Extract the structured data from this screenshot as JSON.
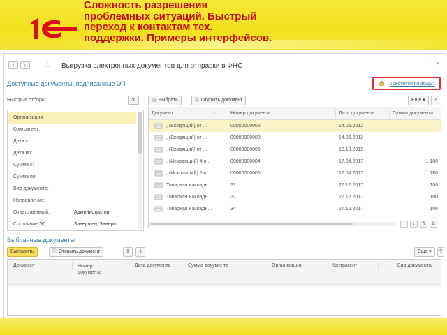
{
  "banner": {
    "title_lines": [
      "Сложность разрешения",
      "проблемных ситуаций. Быстрый",
      "переход к контактам тех.",
      "поддержки. Примеры интерфейсов."
    ],
    "logo_icon": "1c-logo-icon",
    "colors": {
      "banner": "#f3e11c",
      "title": "#c40e0e",
      "logo": "#d8101a"
    }
  },
  "window": {
    "title": "Выгрузка электронных документов для отправки в ФНС",
    "help_link": "Требуется помощь?",
    "nav": {
      "back": "‹",
      "forward": "›"
    },
    "controls": [
      "⋮",
      "×"
    ]
  },
  "top_section": {
    "title": "Доступные документы, подписанные ЭП",
    "filters_label": "Быстрые отборы:",
    "filters_clear": "×",
    "filters": [
      {
        "label": "Организация",
        "value": ""
      },
      {
        "label": "Контрагент:",
        "value": ""
      },
      {
        "label": "Дата с:",
        "value": ""
      },
      {
        "label": "Дата по:",
        "value": ""
      },
      {
        "label": "Сумма с:",
        "value": ""
      },
      {
        "label": "Сумма по:",
        "value": ""
      },
      {
        "label": "Вид документа:",
        "value": ""
      },
      {
        "label": "Направление:",
        "value": ""
      },
      {
        "label": "Ответственный:",
        "value": "Администратор"
      },
      {
        "label": "Состояние ЭД:",
        "value": "Завершен, Заверш"
      }
    ],
    "toolbar": {
      "select": "Выбрать",
      "open": "Открыть документ",
      "more": "Еще",
      "more_arrow": "▾",
      "help": "?"
    },
    "columns": [
      "Документ",
      "Номер документа",
      "Дата документа",
      "Сумма документа"
    ],
    "sort_arrow": "↓",
    "rows": [
      {
        "doc": ", (Входящий)  от ...",
        "number": "00000000002",
        "date": "14.06.2012",
        "sum": "",
        "highlight": true
      },
      {
        "doc": ", (Входящий)  от ...",
        "number": "00000000003",
        "date": "14.06.2012",
        "sum": ""
      },
      {
        "doc": ", (Входящий)  от ...",
        "number": "00000000005",
        "date": "18.10.2012",
        "sum": ""
      },
      {
        "doc": ", (Исходящий) 4 о...",
        "number": "00000000004",
        "date": "17.04.2017",
        "sum": "1 180"
      },
      {
        "doc": ", (Исходящий) 5 о...",
        "number": "00000000005",
        "date": "17.04.2017",
        "sum": "1 180"
      },
      {
        "doc": "Товарная накладн...",
        "number": "31",
        "date": "27.12.2017",
        "sum": "100"
      },
      {
        "doc": "Товарная накладн...",
        "number": "32",
        "date": "27.12.2017",
        "sum": "100"
      },
      {
        "doc": "Товарная накладн...",
        "number": "34",
        "date": "27.12.2017",
        "sum": "100"
      }
    ],
    "scroll_buttons": [
      "↑",
      "↓",
      "⊼",
      "⊻"
    ]
  },
  "bottom_section": {
    "title": "Выбранные документы",
    "toolbar": {
      "export": "Выгрузить",
      "open": "Открыть документ",
      "up": "⇧",
      "down": "⇩",
      "more": "Еще",
      "more_arrow": "▾",
      "help": "?"
    },
    "columns": [
      "Документ",
      "Номер документа",
      "Дата документа",
      "Сумма документа",
      "Организация",
      "Контрагент",
      "Вид документа"
    ]
  }
}
